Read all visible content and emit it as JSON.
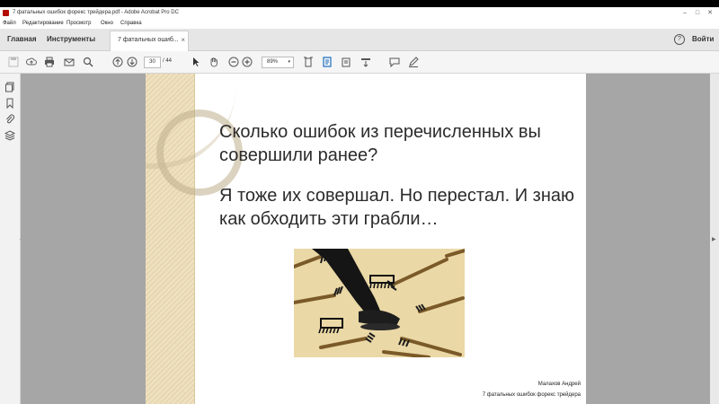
{
  "window": {
    "title": "7 фатальных ошибок форекс трейдера.pdf - Adobe Acrobat Pro DC",
    "controls": {
      "minimize": "–",
      "maximize": "□",
      "close": "✕"
    }
  },
  "menu": {
    "items": [
      "Файл",
      "Редактирование",
      "Просмотр",
      "Окно",
      "Справка"
    ]
  },
  "tabs": {
    "home": "Главная",
    "tools": "Инструменты",
    "document": "7 фатальных ошиб...",
    "document_close": "×"
  },
  "header": {
    "help": "?",
    "signin": "Войти"
  },
  "toolbar": {
    "page_current": "30",
    "page_total": "/ 44",
    "zoom": "89%",
    "zoom_arrow": "▾"
  },
  "slide": {
    "paragraph1": "Сколько ошибок из перечисленных вы совершили ранее?",
    "paragraph2": "Я тоже их совершал. Но перестал. И знаю как обходить эти грабли…",
    "author": "Малахов Андрей",
    "subtitle": "7 фатальных ошибок форекс трейдера"
  },
  "colors": {
    "acrobat_red": "#b30b00",
    "doc_bg": "#a6a6a6",
    "slide_band": "#efe2c2",
    "image_bg": "#e8d5a3"
  }
}
